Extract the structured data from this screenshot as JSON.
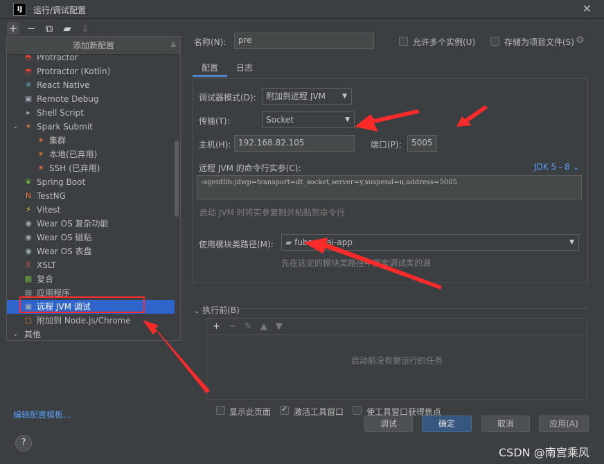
{
  "window": {
    "title": "运行/调试配置",
    "app_icon": "IJ"
  },
  "left_toolbar": [
    "+",
    "−",
    "⧉",
    "📁",
    "↓²"
  ],
  "popup": {
    "title": "添加新配置",
    "items": [
      {
        "label": "Protractor",
        "icon": "protractor-icon",
        "color": "#e03c31",
        "indent": 1
      },
      {
        "label": "Protractor (Kotlin)",
        "icon": "protractor-kotlin-icon",
        "color": "#e03c31",
        "indent": 1
      },
      {
        "label": "React Native",
        "icon": "react-icon",
        "color": "#61dafb",
        "indent": 1
      },
      {
        "label": "Remote Debug",
        "icon": "remote-debug-icon",
        "color": "#9aa7b0",
        "indent": 1
      },
      {
        "label": "Shell Script",
        "icon": "shell-icon",
        "color": "#9aa7b0",
        "indent": 1
      },
      {
        "label": "Spark Submit",
        "icon": "spark-icon",
        "color": "#e8793b",
        "indent": 1,
        "expanded": true
      },
      {
        "label": "集群",
        "icon": "spark-icon",
        "color": "#e8793b",
        "indent": 2
      },
      {
        "label": "本地(已弃用)",
        "icon": "spark-icon",
        "color": "#e8793b",
        "indent": 2
      },
      {
        "label": "SSH (已弃用)",
        "icon": "spark-icon",
        "color": "#e8793b",
        "indent": 2
      },
      {
        "label": "Spring Boot",
        "icon": "spring-icon",
        "color": "#6db33f",
        "indent": 1
      },
      {
        "label": "TestNG",
        "icon": "testng-icon",
        "color": "#e8793b",
        "indent": 1
      },
      {
        "label": "Vitest",
        "icon": "vitest-icon",
        "color": "#fcc72b",
        "indent": 1
      },
      {
        "label": "Wear OS 复杂功能",
        "icon": "wearos-icon",
        "color": "#9aa7b0",
        "indent": 1
      },
      {
        "label": "Wear OS 磁贴",
        "icon": "wearos-icon",
        "color": "#9aa7b0",
        "indent": 1
      },
      {
        "label": "Wear OS 表盘",
        "icon": "wearos-icon",
        "color": "#9aa7b0",
        "indent": 1
      },
      {
        "label": "XSLT",
        "icon": "xslt-icon",
        "color": "#c94f4f",
        "indent": 1
      },
      {
        "label": "复合",
        "icon": "compound-icon",
        "color": "#6db33f",
        "indent": 1
      },
      {
        "label": "应用程序",
        "icon": "application-icon",
        "color": "#9aa7b0",
        "indent": 1
      },
      {
        "label": "远程 JVM 调试",
        "icon": "remote-jvm-icon",
        "color": "#9aa7b0",
        "indent": 1,
        "selected": true
      },
      {
        "label": "附加到 Node.js/Chrome",
        "icon": "nodejs-icon",
        "color": "#e8793b",
        "indent": 1
      },
      {
        "label": "其他",
        "icon": "",
        "color": "#9aa7b0",
        "indent": 0,
        "expanded": true
      }
    ]
  },
  "edit_templates_link": "编辑配置模板...",
  "config": {
    "name_label": "名称(N):",
    "name_value": "pre",
    "allow_multiple_label": "允许多个实例(U)",
    "store_as_file_label": "存储为项目文件(S)",
    "tabs": [
      "配置",
      "日志"
    ],
    "debugger_mode_label": "调试器模式(D):",
    "debugger_mode_value": "附加到远程 JVM",
    "transport_label": "传输(T):",
    "transport_value": "Socket",
    "host_label": "主机(H):",
    "host_value": "192.168.82.105",
    "port_label": "端口(P):",
    "port_value": "5005",
    "cmd_label": "远程 JVM 的命令行实参(C):",
    "jdk_link": "JDK 5 - 8",
    "cmd_value": "-agentlib:jdwp=transport=dt_socket,server=y,suspend=n,address=5005",
    "cmd_hint": "启动 JVM 时将实参复制并粘贴到命令行",
    "module_label": "使用模块类路径(M):",
    "module_value": "fubao-dai-app",
    "module_hint": "先在选定的模块类路径中搜索调试类的源",
    "before_launch_label": "执行前(B)",
    "before_launch_empty": "启动前没有要运行的任务",
    "show_page_label": "显示此页面",
    "activate_tool_label": "激活工具窗口",
    "focus_tool_label": "使工具窗口获得焦点"
  },
  "buttons": {
    "debug": "调试",
    "ok": "确定",
    "cancel": "取消",
    "apply": "应用(A)"
  },
  "watermark": "CSDN @南宫乘风",
  "colors": {
    "accent": "#2f65ca",
    "link": "#589df6",
    "annotation": "#ff2a2a"
  }
}
